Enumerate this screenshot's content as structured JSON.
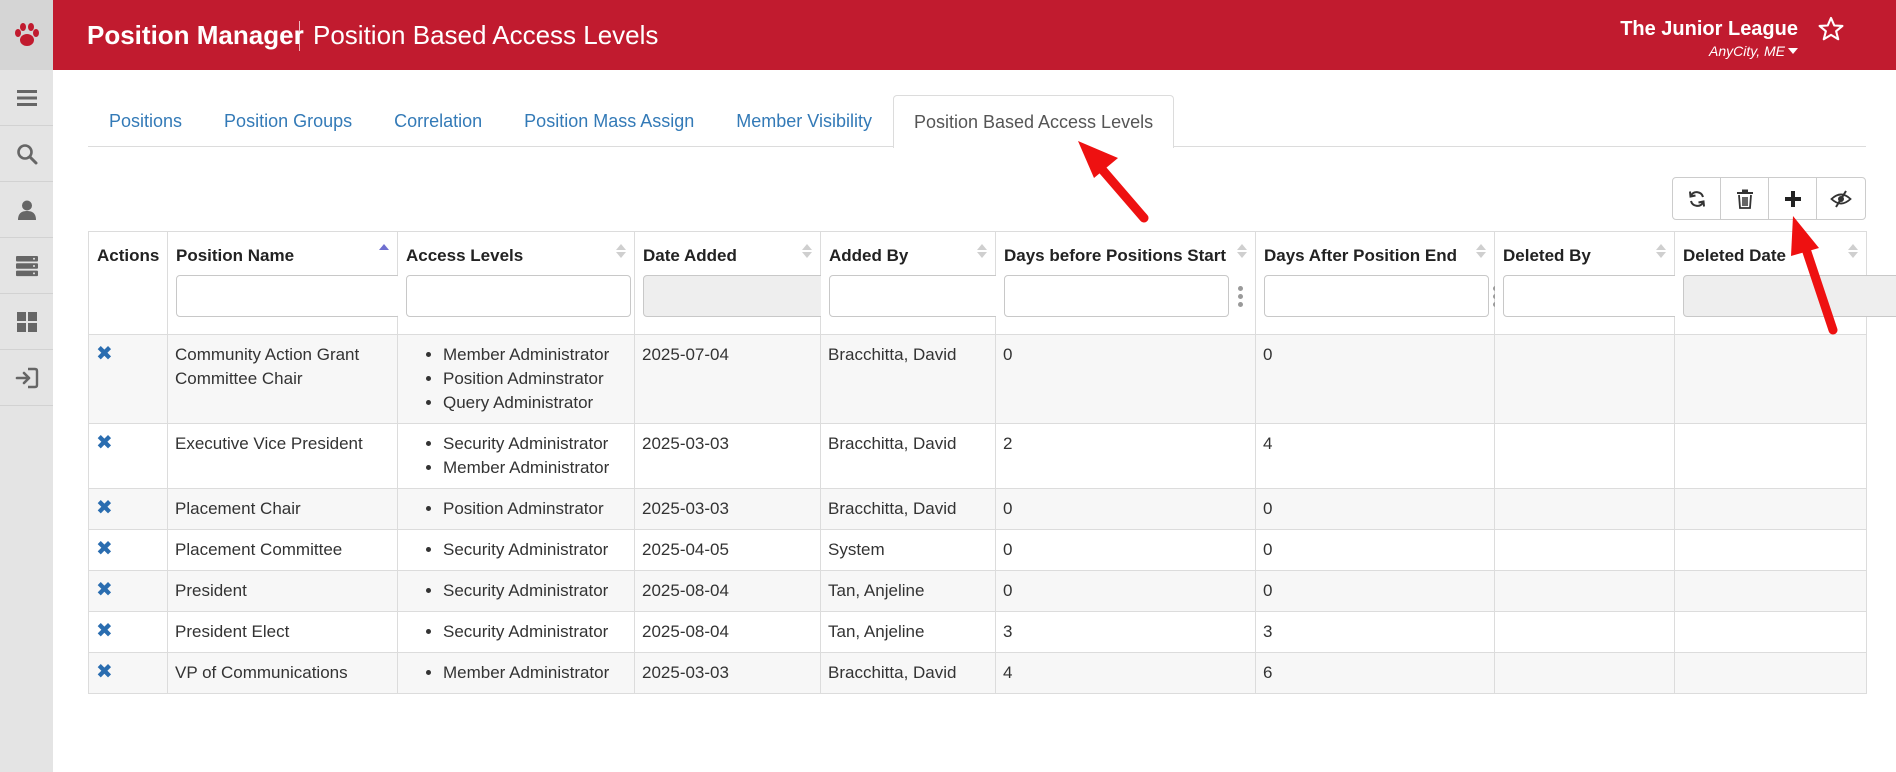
{
  "header": {
    "app_title": "Position Manager",
    "page_title": "Position Based Access Levels",
    "org_name": "The Junior League",
    "org_location": "AnyCity, ME",
    "logo_icon": "paw-icon",
    "favorite_icon": "star-icon",
    "brand_color": "#c11b2f"
  },
  "sidebar": {
    "items": [
      {
        "icon": "hamburger-menu-icon"
      },
      {
        "icon": "search-icon"
      },
      {
        "icon": "user-icon"
      },
      {
        "icon": "server-icon"
      },
      {
        "icon": "dashboard-icon"
      },
      {
        "icon": "sign-out-icon"
      }
    ]
  },
  "tabs": [
    {
      "label": "Positions",
      "active": false
    },
    {
      "label": "Position Groups",
      "active": false
    },
    {
      "label": "Correlation",
      "active": false
    },
    {
      "label": "Position Mass Assign",
      "active": false
    },
    {
      "label": "Member Visibility",
      "active": false
    },
    {
      "label": "Position Based Access Levels",
      "active": true
    }
  ],
  "toolbar": {
    "buttons": [
      {
        "icon": "refresh-icon"
      },
      {
        "icon": "trash-icon"
      },
      {
        "icon": "plus-icon"
      },
      {
        "icon": "eye-slash-icon"
      }
    ]
  },
  "table": {
    "columns": [
      {
        "label": "Actions",
        "sortable": false,
        "filter": "none"
      },
      {
        "label": "Position Name",
        "sortable": true,
        "sorted": "asc",
        "filter": "text"
      },
      {
        "label": "Access Levels",
        "sortable": true,
        "filter": "text"
      },
      {
        "label": "Date Added",
        "sortable": true,
        "filter": "disabled"
      },
      {
        "label": "Added By",
        "sortable": true,
        "filter": "text"
      },
      {
        "label": "Days before Positions Start",
        "sortable": true,
        "filter": "text"
      },
      {
        "label": "Days After Position End",
        "sortable": true,
        "filter": "text"
      },
      {
        "label": "Deleted By",
        "sortable": true,
        "filter": "text"
      },
      {
        "label": "Deleted Date",
        "sortable": true,
        "filter": "disabled"
      }
    ],
    "rows": [
      {
        "action": "✖",
        "position": "Community Action Grant Committee Chair",
        "access_levels": [
          "Member Administrator",
          "Position Adminstrator",
          "Query Administrator"
        ],
        "date_added": "2025-07-04",
        "added_by": "Bracchitta, David",
        "days_before": "0",
        "days_after": "0",
        "deleted_by": "",
        "deleted_date": ""
      },
      {
        "action": "✖",
        "position": "Executive Vice President",
        "access_levels": [
          "Security Administrator",
          "Member Administrator"
        ],
        "date_added": "2025-03-03",
        "added_by": "Bracchitta, David",
        "days_before": "2",
        "days_after": "4",
        "deleted_by": "",
        "deleted_date": ""
      },
      {
        "action": "✖",
        "position": "Placement Chair",
        "access_levels": [
          "Position Adminstrator"
        ],
        "date_added": "2025-03-03",
        "added_by": "Bracchitta, David",
        "days_before": "0",
        "days_after": "0",
        "deleted_by": "",
        "deleted_date": ""
      },
      {
        "action": "✖",
        "position": "Placement Committee",
        "access_levels": [
          "Security Administrator"
        ],
        "date_added": "2025-04-05",
        "added_by": "System",
        "days_before": "0",
        "days_after": "0",
        "deleted_by": "",
        "deleted_date": ""
      },
      {
        "action": "✖",
        "position": "President",
        "access_levels": [
          "Security Administrator"
        ],
        "date_added": "2025-08-04",
        "added_by": "Tan, Anjeline",
        "days_before": "0",
        "days_after": "0",
        "deleted_by": "",
        "deleted_date": ""
      },
      {
        "action": "✖",
        "position": "President Elect",
        "access_levels": [
          "Security Administrator"
        ],
        "date_added": "2025-08-04",
        "added_by": "Tan, Anjeline",
        "days_before": "3",
        "days_after": "3",
        "deleted_by": "",
        "deleted_date": ""
      },
      {
        "action": "✖",
        "position": "VP of Communications",
        "access_levels": [
          "Member Administrator"
        ],
        "date_added": "2025-03-03",
        "added_by": "Bracchitta, David",
        "days_before": "4",
        "days_after": "6",
        "deleted_by": "",
        "deleted_date": ""
      }
    ]
  },
  "annotations": {
    "arrow_color": "#ee1111"
  }
}
